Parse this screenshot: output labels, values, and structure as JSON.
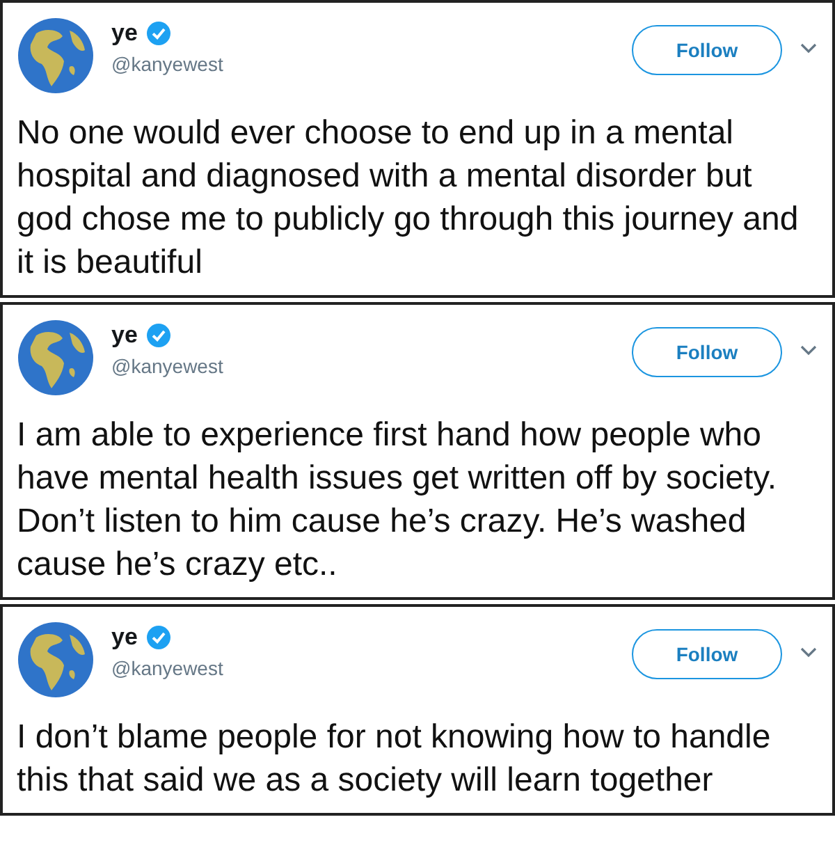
{
  "tweets": [
    {
      "name": "ye",
      "verified": true,
      "handle": "@kanyewest",
      "button": "Follow",
      "menu_caret": true,
      "text": "No one would ever choose to end up in a mental hospital and diagnosed with a mental disorder but god chose me to publicly go through this journey and it is beautiful"
    },
    {
      "name": "ye",
      "verified": true,
      "handle": "@kanyewest",
      "button": "Follow",
      "menu_caret": true,
      "text": "I am able to experience first hand how people who have mental health issues get written off by society.    Don’t listen to him cause he’s crazy. He’s washed cause he’s crazy etc.."
    },
    {
      "name": "ye",
      "verified": true,
      "handle": "@kanyewest",
      "button": "Follow",
      "menu_caret": true,
      "text": "I don’t blame people for not knowing how to handle this that said we as a society will learn together"
    }
  ]
}
